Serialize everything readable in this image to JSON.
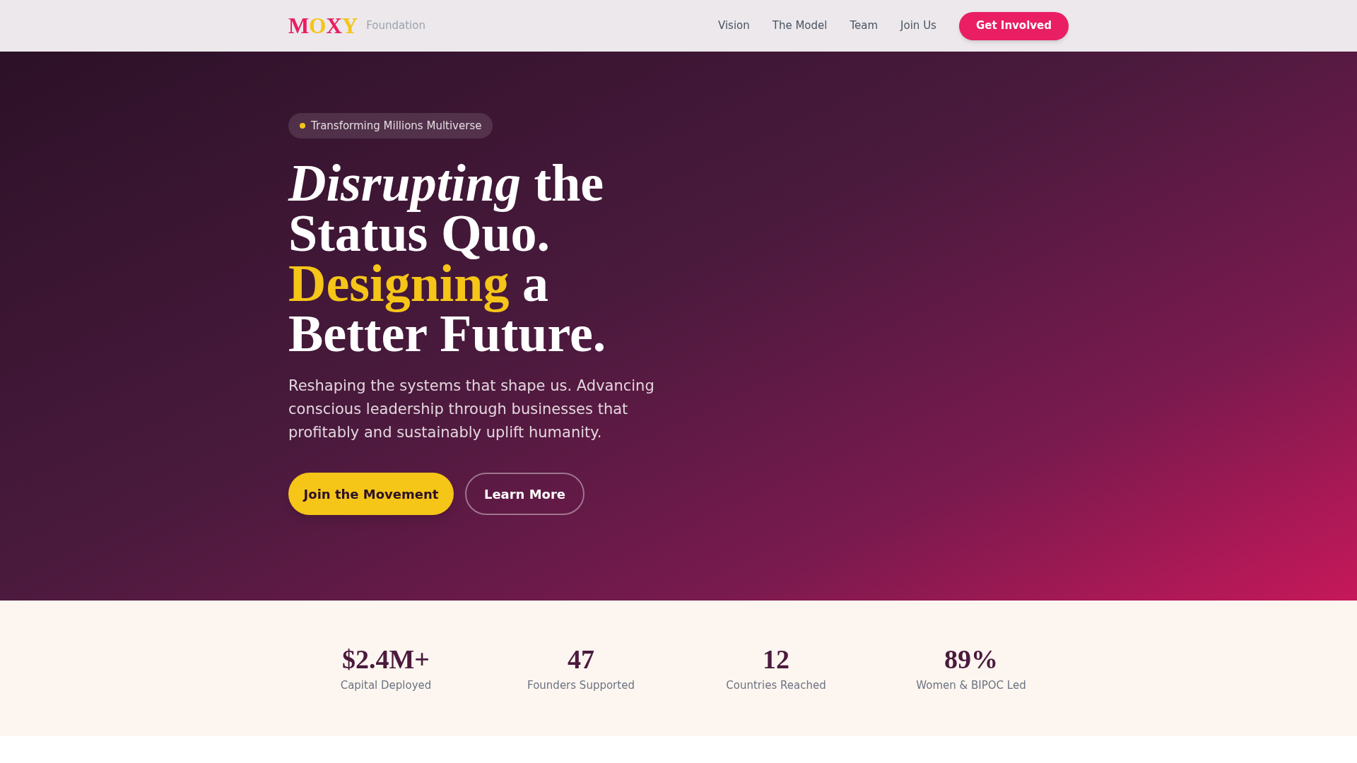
{
  "nav": {
    "logo_letters": [
      {
        "text": "M",
        "color": "#e91e63"
      },
      {
        "text": "O",
        "color": "#f5c518"
      },
      {
        "text": "X",
        "color": "#e91e63"
      },
      {
        "text": "Y",
        "color": "#f5c518"
      }
    ],
    "logo_suffix": "Foundation",
    "links": [
      "Vision",
      "The Model",
      "Team",
      "Join Us"
    ],
    "cta": "Get Involved"
  },
  "hero": {
    "badge": "Transforming Millions Multiverse",
    "headline": [
      [
        {
          "text": "Disrupting",
          "kind": "italic"
        },
        {
          "text": " the",
          "kind": "plain"
        }
      ],
      [
        {
          "text": "Status Quo.",
          "kind": "plain"
        }
      ],
      [
        {
          "text": "Designing",
          "kind": "highlight"
        },
        {
          "text": " a",
          "kind": "plain"
        }
      ],
      [
        {
          "text": "Better Future.",
          "kind": "plain"
        }
      ]
    ],
    "description": "Reshaping the systems that shape us. Advancing conscious leadership through businesses that profitably and sustainably uplift humanity.",
    "primary_button": "Join the Movement",
    "secondary_button": "Learn More"
  },
  "stats": [
    {
      "value": "$2.4M+",
      "label": "Capital Deployed"
    },
    {
      "value": "47",
      "label": "Founders Supported"
    },
    {
      "value": "12",
      "label": "Countries Reached"
    },
    {
      "value": "89%",
      "label": "Women & BIPOC Led"
    }
  ]
}
